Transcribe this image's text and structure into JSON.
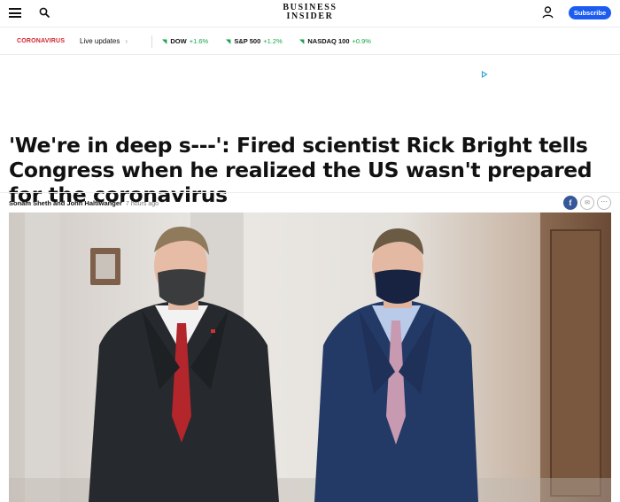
{
  "header": {
    "logo_line1": "BUSINESS",
    "logo_line2": "INSIDER",
    "subscribe_label": "Subscribe"
  },
  "ticker": {
    "topic": "CORONAVIRUS",
    "live_label": "Live updates",
    "markets": [
      {
        "name": "DOW",
        "change": "+1.6%"
      },
      {
        "name": "S&P 500",
        "change": "+1.2%"
      },
      {
        "name": "NASDAQ 100",
        "change": "+0.9%"
      }
    ]
  },
  "article": {
    "headline": "'We're in deep s---': Fired scientist Rick Bright tells Congress when he realized the US wasn't prepared for the coronavirus",
    "authors": "Sonam Sheth and John Haltiwanger",
    "time": "7 hours ago"
  },
  "icons": {
    "menu": "hamburger-menu-icon",
    "search": "search-icon",
    "user": "user-icon",
    "share_facebook": "facebook-icon",
    "share_email": "email-icon",
    "share_more": "more-icon",
    "market_up": "up-arrow-icon"
  },
  "colors": {
    "brand_blue": "#1c5cf0",
    "coronavirus_red": "#d1252f",
    "market_up_green": "#16a34a",
    "facebook_blue": "#365899"
  }
}
